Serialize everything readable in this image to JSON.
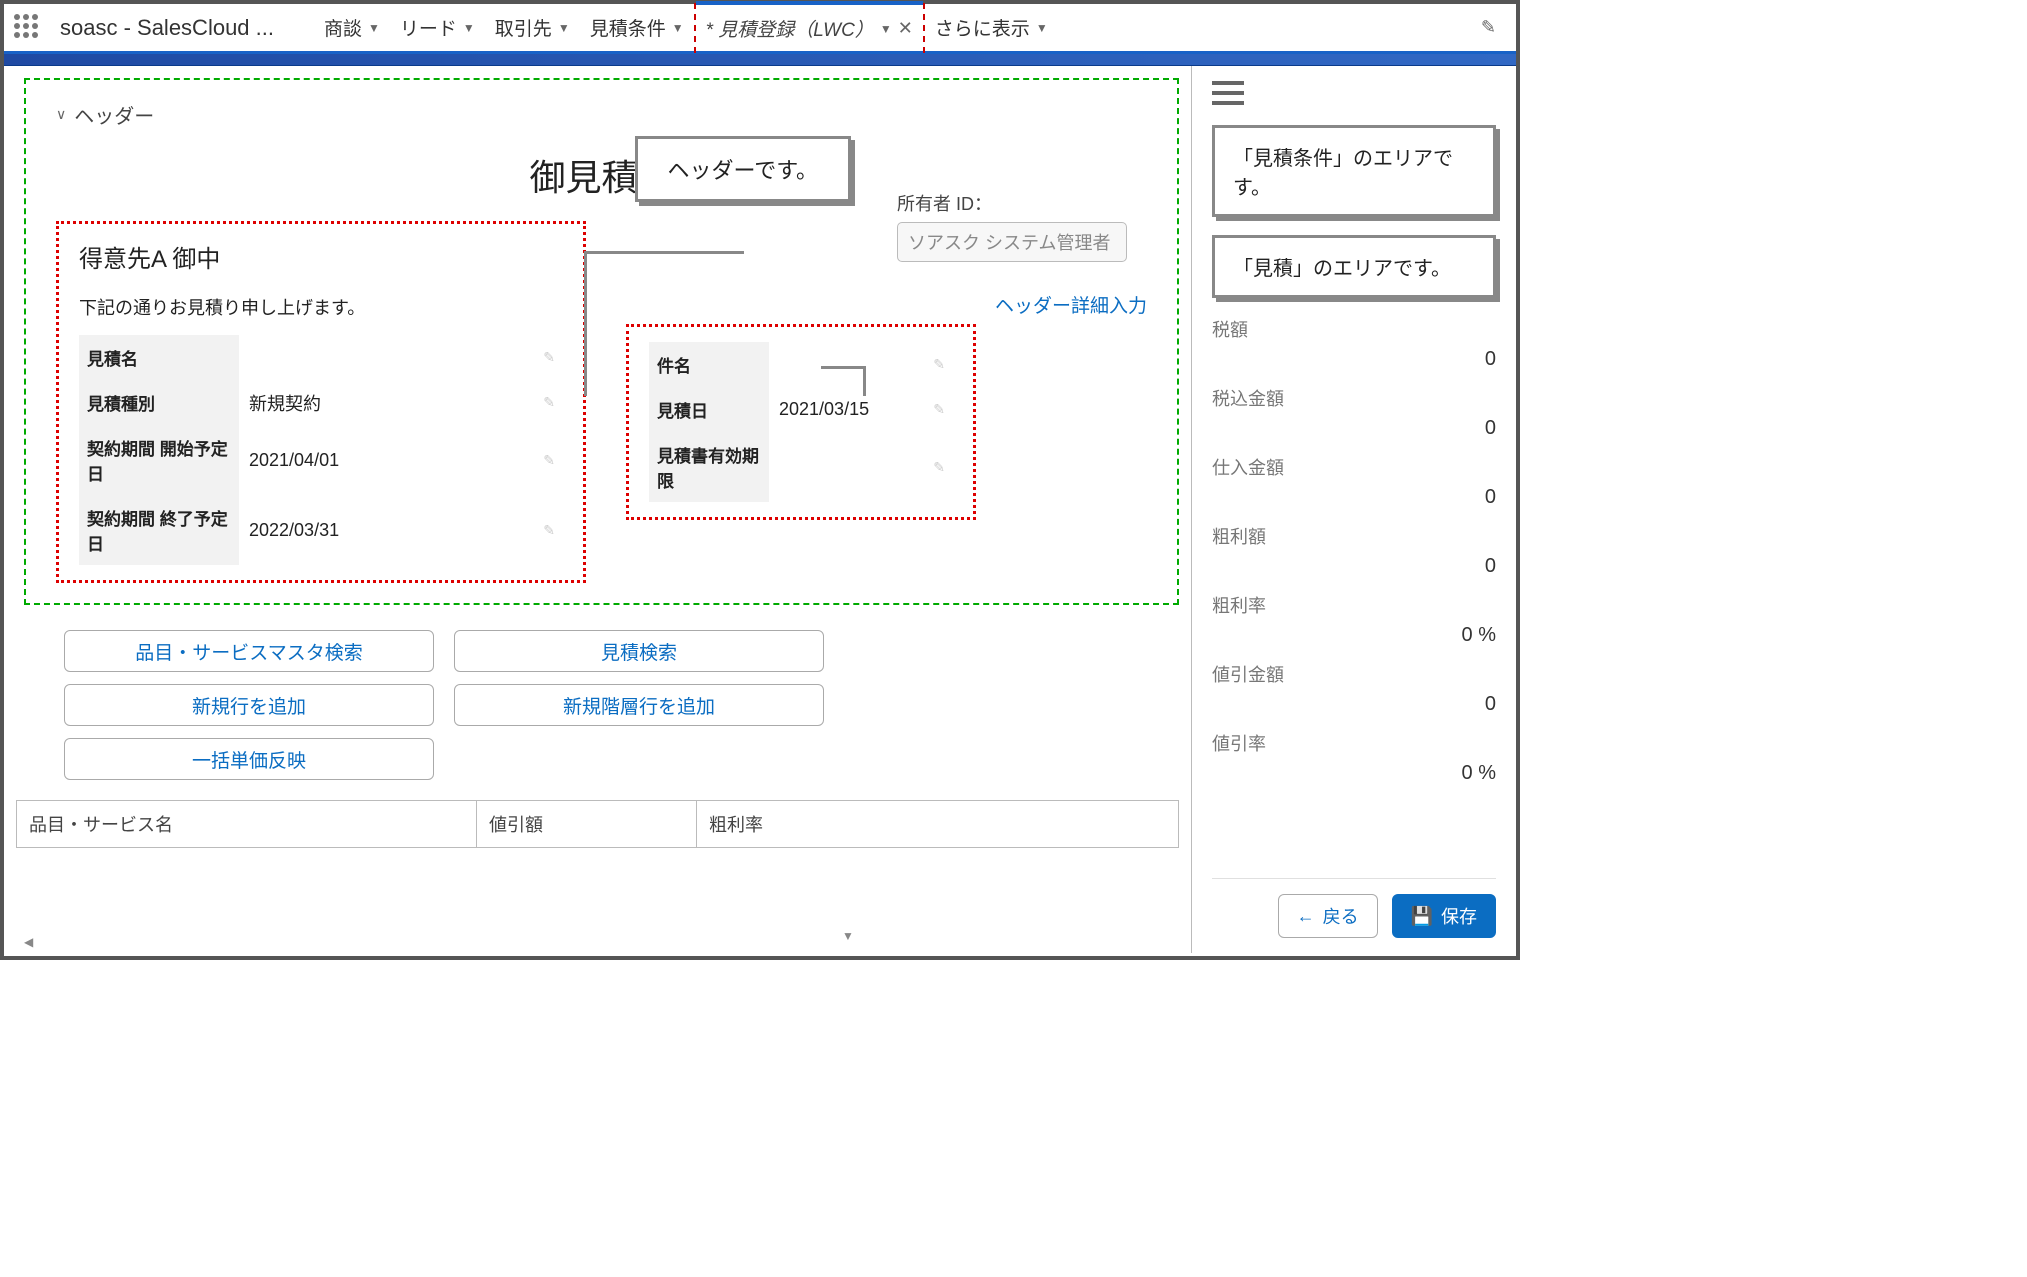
{
  "app_title": "soasc - SalesCloud ...",
  "tabs": [
    {
      "label": "商談"
    },
    {
      "label": "リード"
    },
    {
      "label": "取引先"
    },
    {
      "label": "見積条件"
    }
  ],
  "active_tab": {
    "label": "* 見積登録（LWC）"
  },
  "more_label": "さらに表示",
  "section_header": "ヘッダー",
  "doc_title": "御見積書",
  "owner": {
    "label": "所有者 ID：",
    "value": "ソアスク システム管理者"
  },
  "customer_title": "得意先A 御中",
  "intro": "下記の通りお見積り申し上げます。",
  "left_fields": [
    {
      "label": "見積名",
      "value": ""
    },
    {
      "label": "見積種別",
      "value": "新規契約"
    },
    {
      "label": "契約期間 開始予定日",
      "value": "2021/04/01"
    },
    {
      "label": "契約期間 終了予定日",
      "value": "2022/03/31"
    }
  ],
  "header_link": "ヘッダー詳細入力",
  "right_fields": [
    {
      "label": "件名",
      "value": ""
    },
    {
      "label": "見積日",
      "value": "2021/03/15"
    },
    {
      "label": "見積書有効期限",
      "value": ""
    }
  ],
  "buttons": {
    "item_search": "品目・サービスマスタ検索",
    "quote_search": "見積検索",
    "add_row": "新規行を追加",
    "add_tier_row": "新規階層行を追加",
    "bulk_price": "一括単価反映"
  },
  "table_headers": [
    "品目・サービス名",
    "値引額",
    "粗利率"
  ],
  "callout_header": "ヘッダーです。",
  "callouts": {
    "conditions": "「見積条件」のエリアです。",
    "quote": "「見積」のエリアです。"
  },
  "metrics": [
    {
      "label": "税額",
      "value": "0"
    },
    {
      "label": "税込金額",
      "value": "0"
    },
    {
      "label": "仕入金額",
      "value": "0"
    },
    {
      "label": "粗利額",
      "value": "0"
    },
    {
      "label": "粗利率",
      "value": "0 %"
    },
    {
      "label": "値引金額",
      "value": "0"
    },
    {
      "label": "値引率",
      "value": "0 %"
    }
  ],
  "footer": {
    "back": "戻る",
    "save": "保存"
  }
}
